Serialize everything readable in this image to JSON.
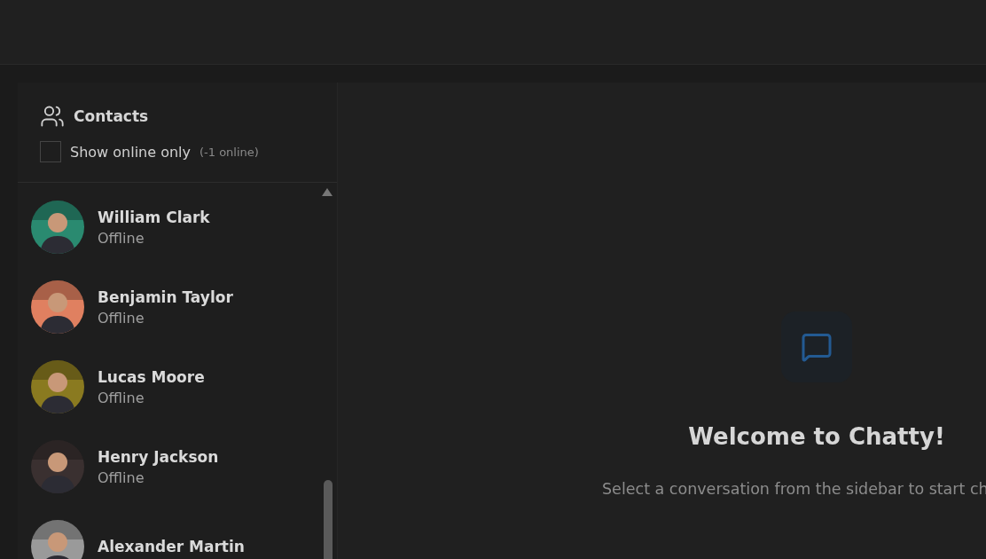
{
  "sidebar": {
    "title": "Contacts",
    "filter": {
      "label": "Show online only",
      "checked": false,
      "count": "(-1 online)"
    },
    "contacts": [
      {
        "name": "William Clark",
        "status": "Offline",
        "online": false,
        "color": "#2a8a70"
      },
      {
        "name": "Benjamin Taylor",
        "status": "Offline",
        "online": false,
        "color": "#e08060"
      },
      {
        "name": "Lucas Moore",
        "status": "Offline",
        "online": false,
        "color": "#8a7a20"
      },
      {
        "name": "Henry Jackson",
        "status": "Offline",
        "online": false,
        "color": "#3a3030"
      },
      {
        "name": "Alexander Martin",
        "color": "#9a9a9a"
      }
    ]
  },
  "welcome": {
    "title": "Welcome to Chatty!",
    "subtitle": "Select a conversation from the sidebar to start ch"
  }
}
